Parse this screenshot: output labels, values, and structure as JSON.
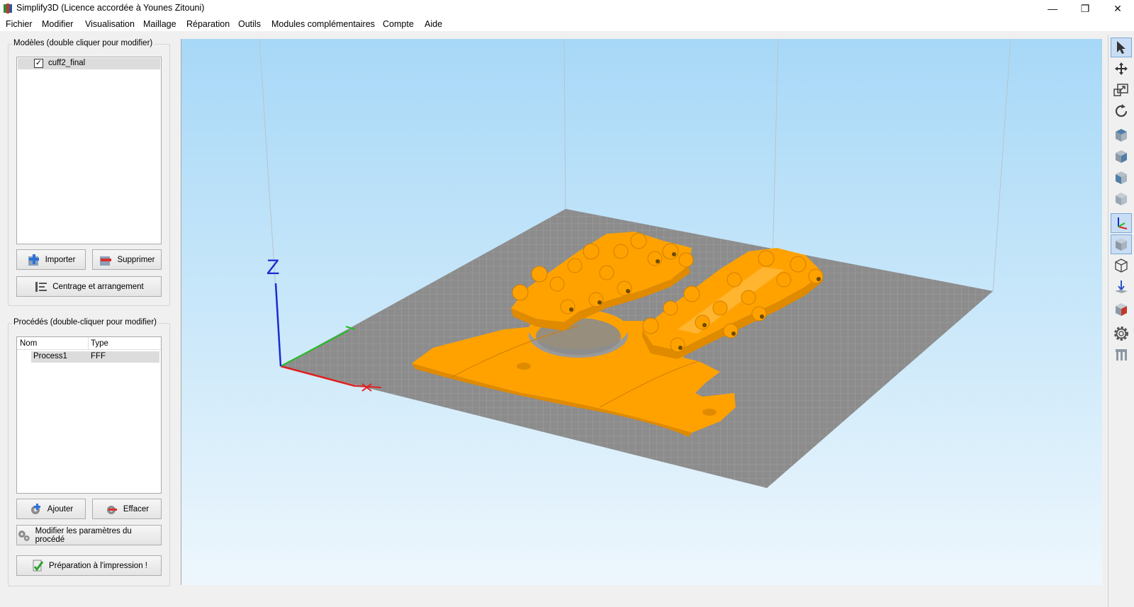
{
  "window": {
    "title": "Simplify3D (Licence accordée à Younes Zitouni)",
    "minimize_glyph": "—",
    "restore_glyph": "❐",
    "close_glyph": "✕"
  },
  "menu": [
    "Fichier",
    "Modifier",
    "Visualisation",
    "Maillage",
    "Réparation",
    "Outils",
    "Modules complémentaires",
    "Compte",
    "Aide"
  ],
  "models": {
    "title": "Modèles (double cliquer pour modifier)",
    "items": [
      {
        "name": "cuff2_final",
        "checked": true,
        "check_glyph": "✓"
      }
    ],
    "import_label": "Importer",
    "delete_label": "Supprimer",
    "center_label": "Centrage et arrangement"
  },
  "processes": {
    "title": "Procédés (double-cliquer pour modifier)",
    "col_name": "Nom",
    "col_type": "Type",
    "rows": [
      {
        "name": "Process1",
        "type": "FFF"
      }
    ],
    "add_label": "Ajouter",
    "remove_label": "Effacer",
    "edit_label": "Modifier les paramètres du procédé",
    "prepare_label": "Préparation à l'impression !"
  },
  "viewport": {
    "axis_z_label": "Z",
    "axis_x_color": "#e02020",
    "axis_y_color": "#1fbf1f",
    "axis_z_color": "#1a2bd0",
    "bed_color": "#8c8c8c",
    "model_color": "#ffa200"
  },
  "toolbar": [
    {
      "icon": "select-arrow-icon",
      "active": true
    },
    {
      "icon": "move-icon",
      "active": false
    },
    {
      "icon": "scale-icon",
      "active": false
    },
    {
      "icon": "rotate-icon",
      "active": false
    },
    {
      "icon": "view-top-icon",
      "active": false
    },
    {
      "icon": "view-front-icon",
      "active": false
    },
    {
      "icon": "view-side-icon",
      "active": false
    },
    {
      "icon": "view-iso-icon",
      "active": false
    },
    {
      "icon": "show-axes-icon",
      "active": true
    },
    {
      "icon": "solid-view-icon",
      "active": true
    },
    {
      "icon": "wireframe-view-icon",
      "active": false
    },
    {
      "icon": "ground-icon",
      "active": false
    },
    {
      "icon": "cross-section-icon",
      "active": false
    },
    {
      "icon": "settings-gear-icon",
      "active": false
    },
    {
      "icon": "supports-icon",
      "active": false
    }
  ]
}
